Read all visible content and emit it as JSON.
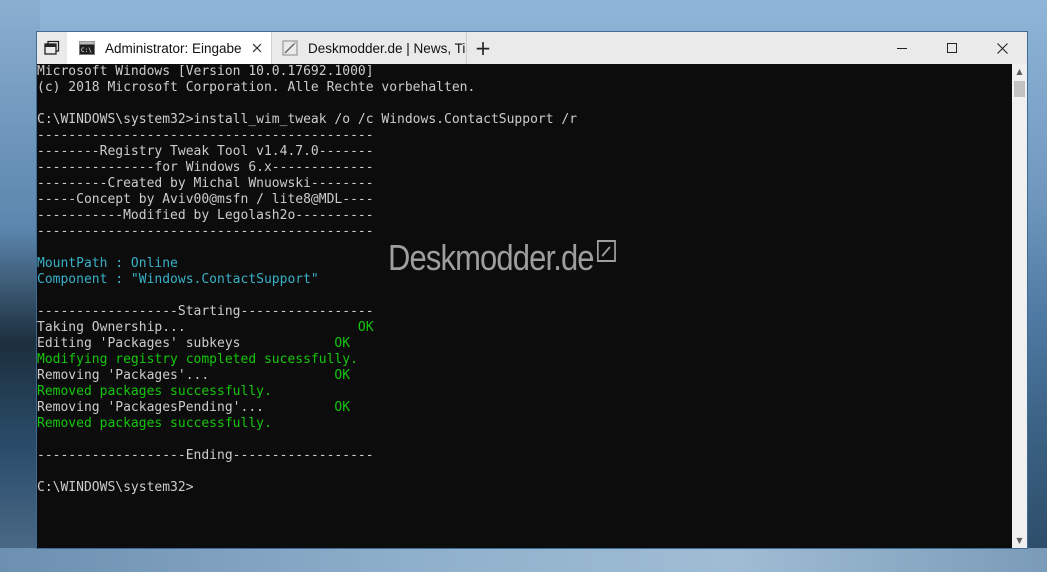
{
  "window": {
    "tabs": [
      {
        "label": "Administrator: Eingabe",
        "icon": "cmd-icon",
        "active": true
      },
      {
        "label": "Deskmodder.de | News, Tip",
        "icon": "browser-page-icon",
        "active": false
      }
    ],
    "new_tab_label": "+",
    "controls": {
      "minimize": "minimize-icon",
      "maximize": "maximize-icon",
      "close": "close-icon"
    }
  },
  "console": {
    "lines": [
      {
        "text": "Microsoft Windows [Version 10.0.17692.1000]",
        "color": "default"
      },
      {
        "text": "(c) 2018 Microsoft Corporation. Alle Rechte vorbehalten.",
        "color": "default"
      },
      {
        "text": "",
        "color": "default"
      },
      {
        "text": "C:\\WINDOWS\\system32>install_wim_tweak /o /c Windows.ContactSupport /r",
        "color": "default"
      },
      {
        "text": "-------------------------------------------",
        "color": "default"
      },
      {
        "text": "--------Registry Tweak Tool v1.4.7.0-------",
        "color": "default"
      },
      {
        "text": "---------------for Windows 6.x-------------",
        "color": "default"
      },
      {
        "text": "---------Created by Michal Wnuowski--------",
        "color": "default"
      },
      {
        "text": "-----Concept by Aviv00@msfn / lite8@MDL----",
        "color": "default"
      },
      {
        "text": "-----------Modified by Legolash2o----------",
        "color": "default"
      },
      {
        "text": "-------------------------------------------",
        "color": "default"
      },
      {
        "text": "",
        "color": "default"
      },
      {
        "text": "MountPath : Online",
        "color": "teal"
      },
      {
        "text": "Component : \"Windows.ContactSupport\"",
        "color": "teal"
      },
      {
        "text": "",
        "color": "default"
      },
      {
        "text": "------------------Starting-----------------",
        "color": "default"
      },
      {
        "segments": [
          {
            "text": "Taking Ownership...                      ",
            "color": "default"
          },
          {
            "text": "OK",
            "color": "green"
          }
        ]
      },
      {
        "segments": [
          {
            "text": "Editing 'Packages' subkeys            ",
            "color": "default"
          },
          {
            "text": "OK",
            "color": "green"
          }
        ]
      },
      {
        "text": "Modifying registry completed sucessfully.",
        "color": "green"
      },
      {
        "segments": [
          {
            "text": "Removing 'Packages'...                ",
            "color": "default"
          },
          {
            "text": "OK",
            "color": "green"
          }
        ]
      },
      {
        "text": "Removed packages successfully.",
        "color": "green"
      },
      {
        "segments": [
          {
            "text": "Removing 'PackagesPending'...         ",
            "color": "default"
          },
          {
            "text": "OK",
            "color": "green"
          }
        ]
      },
      {
        "text": "Removed packages successfully.",
        "color": "green"
      },
      {
        "text": "",
        "color": "default"
      },
      {
        "text": "-------------------Ending------------------",
        "color": "default"
      },
      {
        "text": "",
        "color": "default"
      },
      {
        "text": "C:\\WINDOWS\\system32>",
        "color": "default"
      }
    ]
  },
  "watermark": {
    "text": "Deskmodder.de",
    "icon": "pencil-icon"
  },
  "colors": {
    "console_bg": "#0c0c0c",
    "console_text": "#cccccc",
    "teal": "#3ab0c8",
    "green": "#16c60c"
  }
}
